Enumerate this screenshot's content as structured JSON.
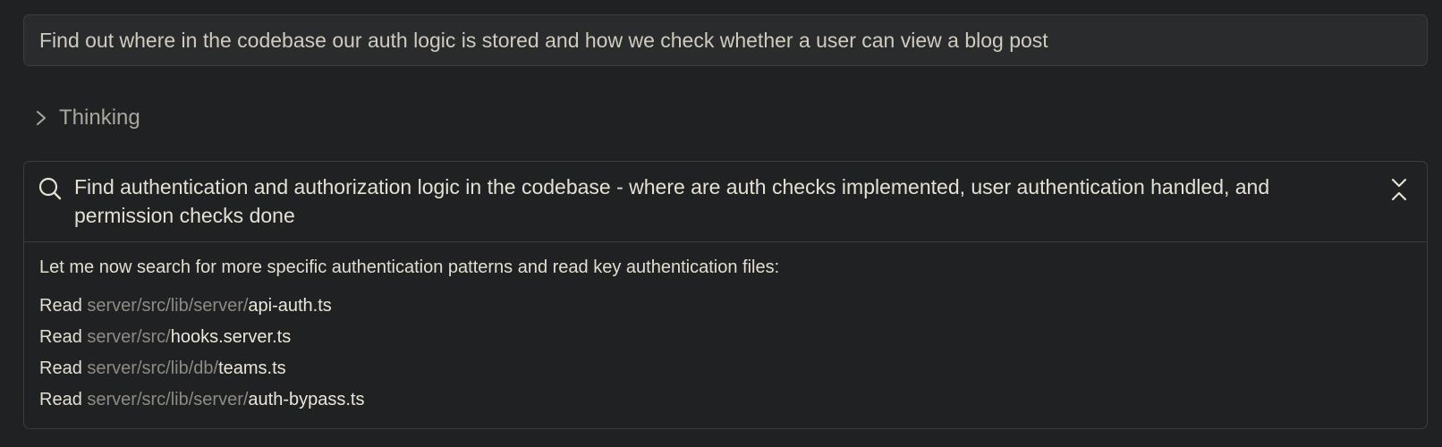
{
  "prompt": {
    "text": "Find out where in the codebase our auth logic is stored and how we check whether a user can view a blog post"
  },
  "thinking": {
    "label": "Thinking",
    "icon": "chevron-right-icon"
  },
  "tool_call": {
    "icon": "search-icon",
    "query": "Find authentication and authorization logic in the codebase - where are auth checks implemented, user authentication handled, and permission checks done",
    "collapse_icon": "collapse-icon",
    "intro": "Let me now search for more specific authentication patterns and read key authentication files:",
    "reads": [
      {
        "verb": "Read",
        "dir": "server/src/lib/server/",
        "file": "api-auth.ts"
      },
      {
        "verb": "Read",
        "dir": "server/src/",
        "file": "hooks.server.ts"
      },
      {
        "verb": "Read",
        "dir": "server/src/lib/db/",
        "file": "teams.ts"
      },
      {
        "verb": "Read",
        "dir": "server/src/lib/server/",
        "file": "auth-bypass.ts"
      }
    ]
  },
  "colors": {
    "background": "#202123",
    "panel": "#2a2b2d",
    "border": "#3c3d40",
    "text": "#e2ded2",
    "muted": "#8e8b84"
  }
}
